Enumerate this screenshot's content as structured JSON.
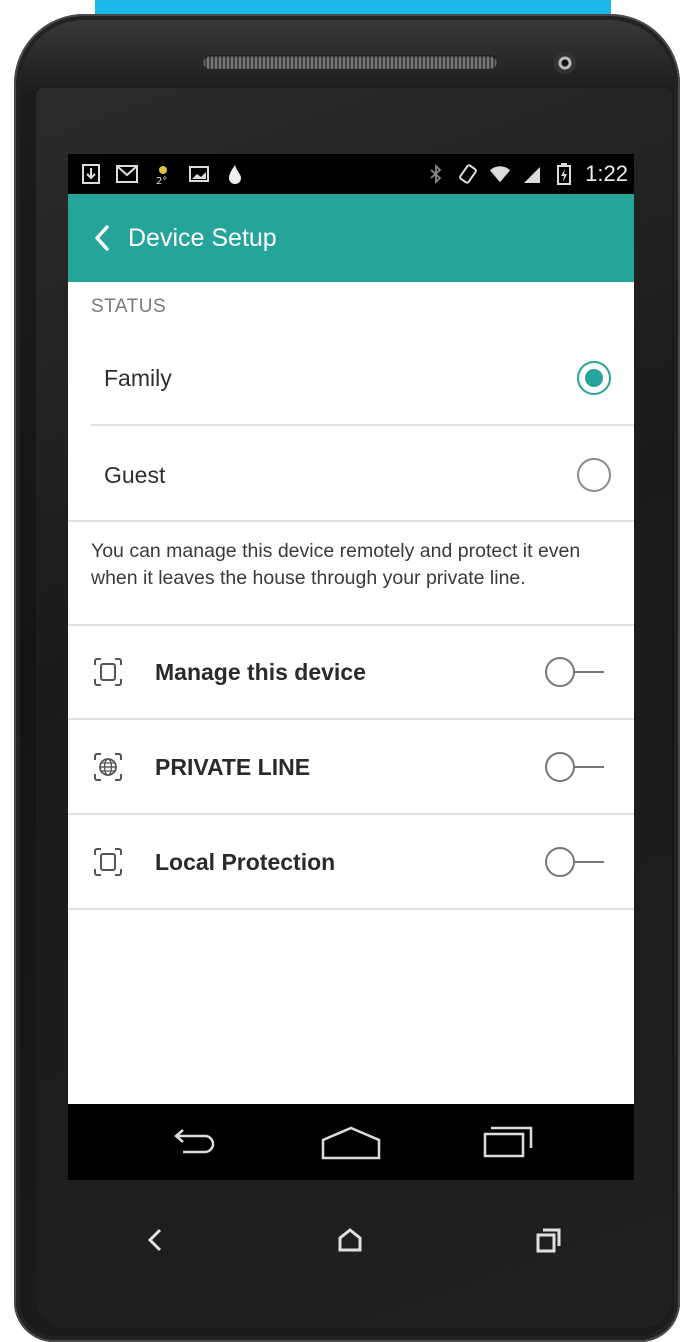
{
  "status_bar": {
    "time": "1:22",
    "icons_left": [
      "download-icon",
      "gmail-icon",
      "weather-icon",
      "image-icon",
      "flame-icon"
    ],
    "icons_right": [
      "bluetooth-icon",
      "rotation-icon",
      "wifi-icon",
      "signal-icon",
      "battery-icon"
    ]
  },
  "app_bar": {
    "title": "Device Setup",
    "color": "#25a59a"
  },
  "status_section": {
    "header": "STATUS",
    "options": [
      {
        "label": "Family",
        "selected": true
      },
      {
        "label": "Guest",
        "selected": false
      }
    ]
  },
  "description": "You can manage this device remotely and protect it even when it leaves the house through your private line.",
  "toggles": [
    {
      "label": "Manage this device",
      "icon": "device-frame-icon",
      "on": false
    },
    {
      "label": "PRIVATE LINE",
      "icon": "globe-frame-icon",
      "on": false
    },
    {
      "label": "Local Protection",
      "icon": "device-frame-icon",
      "on": false
    }
  ],
  "nav_bar": {
    "buttons": [
      "back-icon",
      "home-icon",
      "recents-icon"
    ]
  },
  "hardware_keys": [
    "back-icon",
    "home-icon",
    "recents-icon"
  ]
}
